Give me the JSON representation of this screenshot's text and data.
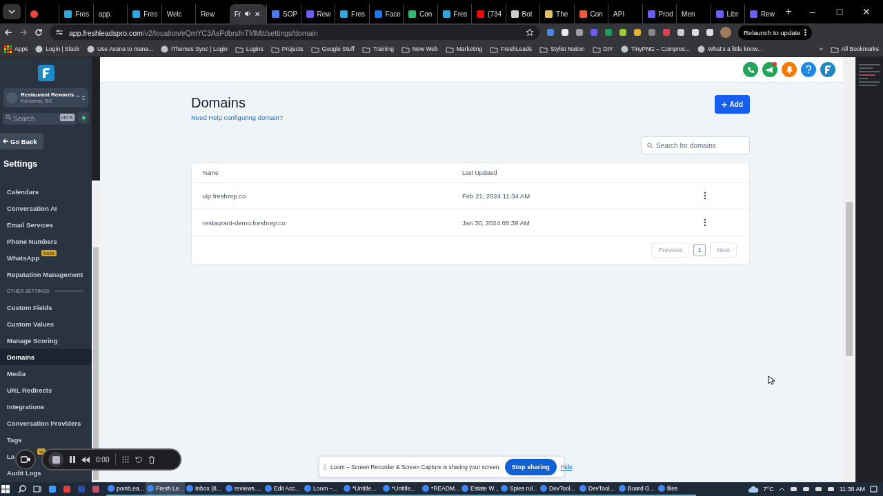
{
  "browser": {
    "tabs": [
      {
        "color": "#e8453c",
        "selected": false
      },
      {
        "label": "Fres",
        "color": "#2aa8e0",
        "selected": false
      },
      {
        "label": "app.",
        "selected": false
      },
      {
        "label": "Fres",
        "color": "#2aa8e0",
        "selected": false
      },
      {
        "label": "Welc",
        "selected": false
      },
      {
        "label": "Rew",
        "selected": false
      },
      {
        "label": "Fr",
        "selected": true
      },
      {
        "label": "SOP",
        "color": "#4a7bf0",
        "selected": false
      },
      {
        "label": "Rew",
        "color": "#6a5cff",
        "selected": false
      },
      {
        "label": "Fres",
        "color": "#2aa8e0",
        "selected": false
      },
      {
        "label": "Face",
        "color": "#1877f2",
        "selected": false
      },
      {
        "label": "Con",
        "color": "#2eb872",
        "selected": false
      },
      {
        "label": "Fres",
        "color": "#2aa8e0",
        "selected": false
      },
      {
        "label": "(734",
        "color": "#ff0000",
        "selected": false
      },
      {
        "label": "Bot",
        "color": "#cccccc",
        "selected": false
      },
      {
        "label": "The",
        "color": "#e0c060",
        "selected": false
      },
      {
        "label": "Con",
        "color": "#e85c3c",
        "selected": false
      },
      {
        "label": "API",
        "selected": false
      },
      {
        "label": "Prod",
        "color": "#6a5cff",
        "selected": false
      },
      {
        "label": "Men",
        "selected": false
      },
      {
        "label": "Libr",
        "color": "#6a5cff",
        "selected": false
      },
      {
        "label": "Rew",
        "color": "#6a5cff",
        "selected": false
      }
    ],
    "new_tab": "+",
    "window_controls": [
      "–",
      "□",
      "✕"
    ],
    "close_tab": "✕",
    "url_host": "app.freshleadspro.com",
    "url_path": "/v2/location/eQmYC3AsPdbrsfnTMMtt/settings/domain",
    "relaunch": "Relaunch to update",
    "bookmarks": [
      {
        "label": "Apps",
        "kind": "apps"
      },
      {
        "label": "Login | Slack",
        "kind": "site"
      },
      {
        "label": "Use Asana to mana...",
        "kind": "site"
      },
      {
        "label": "iThemes Sync | Login",
        "kind": "site"
      },
      {
        "label": "Logins",
        "kind": "folder"
      },
      {
        "label": "Projects",
        "kind": "folder"
      },
      {
        "label": "Google Stuff",
        "kind": "folder"
      },
      {
        "label": "Training",
        "kind": "folder"
      },
      {
        "label": "New Web",
        "kind": "folder"
      },
      {
        "label": "Marketing",
        "kind": "folder"
      },
      {
        "label": "FreshLeads",
        "kind": "folder"
      },
      {
        "label": "Stylist Nation",
        "kind": "folder"
      },
      {
        "label": "DIY",
        "kind": "folder"
      },
      {
        "label": "TinyPNG – Compres...",
        "kind": "site"
      },
      {
        "label": "What's a little know...",
        "kind": "site"
      },
      {
        "label": "»",
        "kind": "more"
      },
      {
        "label": "All Bookmarks",
        "kind": "folder"
      }
    ]
  },
  "sidebar": {
    "account": {
      "name": "Restaurant Rewards ...",
      "location": "Kelowna, BC"
    },
    "search": {
      "placeholder": "Search",
      "shortcut": "ctrl K"
    },
    "back": "Go Back",
    "title": "Settings",
    "items": [
      {
        "label": "Calendars",
        "kind": "item",
        "selected": false
      },
      {
        "label": "Conversation AI",
        "kind": "item",
        "selected": false
      },
      {
        "label": "Email Services",
        "kind": "item",
        "selected": false
      },
      {
        "label": "Phone Numbers",
        "kind": "item",
        "selected": false
      },
      {
        "label": "WhatsApp",
        "kind": "item",
        "badge": "beta",
        "selected": false
      },
      {
        "label": "Reputation Management",
        "kind": "item",
        "selected": false
      },
      {
        "label": "OTHER SETTINGS",
        "kind": "section"
      },
      {
        "label": "Custom Fields",
        "kind": "item",
        "selected": false
      },
      {
        "label": "Custom Values",
        "kind": "item",
        "selected": false
      },
      {
        "label": "Manage Scoring",
        "kind": "item",
        "selected": false
      },
      {
        "label": "Domains",
        "kind": "item",
        "selected": true
      },
      {
        "label": "Media",
        "kind": "item",
        "selected": false
      },
      {
        "label": "URL Redirects",
        "kind": "item",
        "selected": false
      },
      {
        "label": "Integrations",
        "kind": "item",
        "selected": false
      },
      {
        "label": "Conversation Providers",
        "kind": "item",
        "selected": false
      },
      {
        "label": "Tags",
        "kind": "item",
        "selected": false
      },
      {
        "label": "La",
        "kind": "partial",
        "badge": "w",
        "selected": false
      },
      {
        "label": "Audit Logs",
        "kind": "item",
        "selected": false
      }
    ]
  },
  "page": {
    "title": "Domains",
    "help_link": "Need Help configuring domain?",
    "add_button": "Add",
    "search": {
      "placeholder": "Search for domains"
    },
    "table": {
      "columns": [
        "Name",
        "Last Updated"
      ],
      "rows": [
        {
          "name": "vip.freshrep.co",
          "updated": "Feb 21, 2024 11:34 AM"
        },
        {
          "name": "restaurant-demo.freshrep.co",
          "updated": "Jan 30, 2024 08:39 AM"
        }
      ]
    },
    "pagination": {
      "previous": "Previous",
      "pages": [
        {
          "label": "1",
          "selected": true
        }
      ],
      "next": "Next"
    }
  },
  "loom": {
    "timer": "0:00",
    "message": "Loom – Screen Recorder & Screen Capture is sharing your screen.",
    "stop": "Stop sharing",
    "hide": "Hide"
  },
  "taskbar": {
    "apps": [
      {
        "label": "pointLea...",
        "selected": false
      },
      {
        "label": "Fresh Le...",
        "selected": true
      },
      {
        "label": "Inbox (8...",
        "selected": false
      },
      {
        "label": "reviews....",
        "selected": false
      },
      {
        "label": "Edit Acc...",
        "selected": false
      },
      {
        "label": "Loom –...",
        "selected": false
      },
      {
        "label": "*Untitle...",
        "selected": false
      },
      {
        "label": "*Untitle...",
        "selected": false
      },
      {
        "label": "*READM...",
        "selected": false
      },
      {
        "label": "Estate W...",
        "selected": false
      },
      {
        "label": "Spies rul...",
        "selected": false
      },
      {
        "label": "DevTool...",
        "selected": false
      },
      {
        "label": "DevTool...",
        "selected": false
      },
      {
        "label": "Board G...",
        "selected": false
      },
      {
        "label": "files",
        "selected": false
      }
    ],
    "temperature": "7°C",
    "time": "11:38 AM"
  }
}
